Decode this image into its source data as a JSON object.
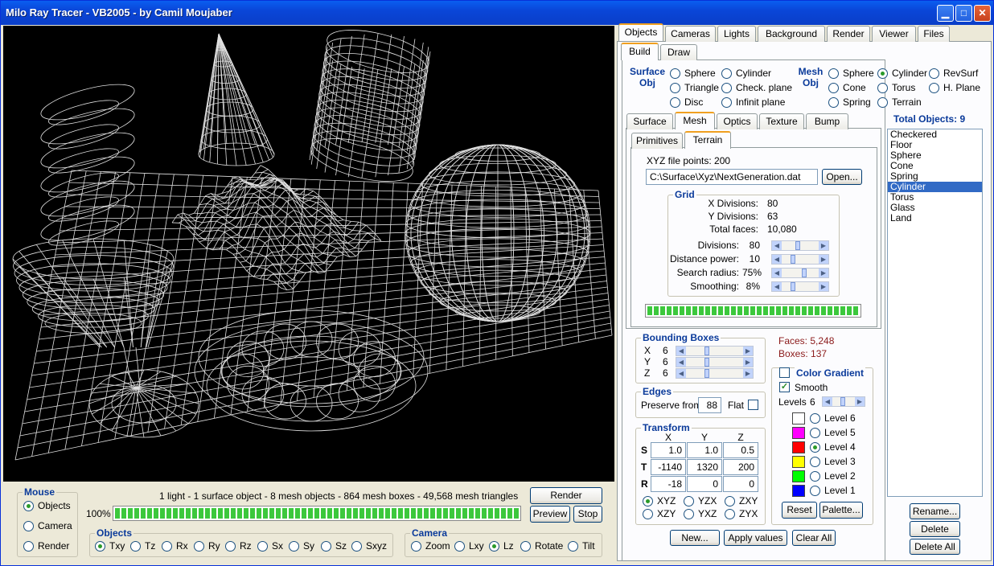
{
  "window": {
    "title": "Milo Ray Tracer - VB2005 - by Camil Moujaber"
  },
  "main_tabs": [
    "Objects",
    "Cameras",
    "Lights",
    "Background",
    "Render",
    "Viewer",
    "Files"
  ],
  "sub_tabs": [
    "Build",
    "Draw"
  ],
  "surface_obj": {
    "label": "Surface Obj",
    "options": [
      "Sphere",
      "Triangle",
      "Disc",
      "Cylinder",
      "Check. plane",
      "Infinit plane"
    ]
  },
  "mesh_obj": {
    "label": "Mesh Obj",
    "options": [
      "Sphere",
      "Cone",
      "Spring",
      "Cylinder",
      "Torus",
      "Terrain",
      "RevSurf",
      "H. Plane"
    ],
    "selected": "Cylinder"
  },
  "prop_tabs": [
    "Surface",
    "Mesh",
    "Optics",
    "Texture",
    "Bump"
  ],
  "mesh_tabs": [
    "Primitives",
    "Terrain"
  ],
  "terrain": {
    "file_points": "XYZ file points: 200",
    "file_path": "C:\\Surface\\Xyz\\NextGeneration.dat",
    "open_label": "Open...",
    "grid_label": "Grid",
    "x_div_label": "X Divisions:",
    "x_div": "80",
    "y_div_label": "Y Divisions:",
    "y_div": "63",
    "faces_label": "Total faces:",
    "faces": "10,080",
    "divisions_label": "Divisions:",
    "divisions": "80",
    "divisions_pos": 0.4,
    "dist_label": "Distance power:",
    "dist": "10",
    "dist_pos": 0.25,
    "radius_label": "Search radius:",
    "radius": "75%",
    "radius_pos": 0.6,
    "smooth_label": "Smoothing:",
    "smooth": "8%",
    "smooth_pos": 0.25,
    "progress": 1.0
  },
  "bounding": {
    "label": "Bounding Boxes",
    "x_label": "X",
    "x": "6",
    "y_label": "Y",
    "y": "6",
    "z_label": "Z",
    "z": "6",
    "pos": 0.35
  },
  "stats": {
    "faces": "Faces: 5,248",
    "boxes": "Boxes: 137"
  },
  "edges": {
    "label": "Edges",
    "preserve_label": "Preserve from",
    "preserve": "88",
    "flat_label": "Flat"
  },
  "transform": {
    "label": "Transform",
    "cols": [
      "X",
      "Y",
      "Z"
    ],
    "s_label": "S",
    "s": [
      "1.0",
      "1.0",
      "0.5"
    ],
    "t_label": "T",
    "t": [
      "-1140",
      "1320",
      "200"
    ],
    "r_label": "R",
    "r": [
      "-18",
      "0",
      "0"
    ],
    "orders": [
      "XYZ",
      "YZX",
      "ZXY",
      "XZY",
      "YXZ",
      "ZYX"
    ],
    "order_selected": "XYZ"
  },
  "gradient": {
    "label": "Color Gradient",
    "smooth_label": "Smooth",
    "levels_label": "Levels",
    "levels": "6",
    "items": [
      {
        "label": "Level 6",
        "color": "#ffffff"
      },
      {
        "label": "Level 5",
        "color": "#ff00ff"
      },
      {
        "label": "Level 4",
        "color": "#ff0000"
      },
      {
        "label": "Level 3",
        "color": "#ffff00"
      },
      {
        "label": "Level 2",
        "color": "#00ff00"
      },
      {
        "label": "Level 1",
        "color": "#0000ff"
      }
    ],
    "selected": "Level 4",
    "reset_label": "Reset",
    "palette_label": "Palette..."
  },
  "actions": {
    "new": "New...",
    "apply": "Apply values",
    "clear": "Clear All"
  },
  "objects": {
    "total": "Total Objects: 9",
    "items": [
      "Checkered Floor",
      "Sphere",
      "Cone",
      "Spring",
      "Cylinder",
      "Torus",
      "Glass",
      "Land"
    ],
    "selected": "Cylinder"
  },
  "list_actions": {
    "rename": "Rename...",
    "delete": "Delete",
    "delete_all": "Delete All"
  },
  "status": {
    "text": "1 light - 1 surface object - 8 mesh objects - 864 mesh boxes - 49,568 mesh triangles",
    "percent": "100%",
    "progress": 1.0
  },
  "render": {
    "render": "Render",
    "preview": "Preview",
    "stop": "Stop"
  },
  "mouse": {
    "label": "Mouse",
    "options": [
      "Objects",
      "Camera",
      "Render"
    ],
    "selected": "Objects"
  },
  "objects_mode": {
    "label": "Objects",
    "options": [
      "Txy",
      "Tz",
      "Rx",
      "Ry",
      "Rz",
      "Sx",
      "Sy",
      "Sz",
      "Sxyz"
    ],
    "selected": "Txy"
  },
  "camera_mode": {
    "label": "Camera",
    "options": [
      "Zoom",
      "Lxy",
      "Lz",
      "Rotate",
      "Tilt"
    ],
    "selected": "Lz"
  }
}
